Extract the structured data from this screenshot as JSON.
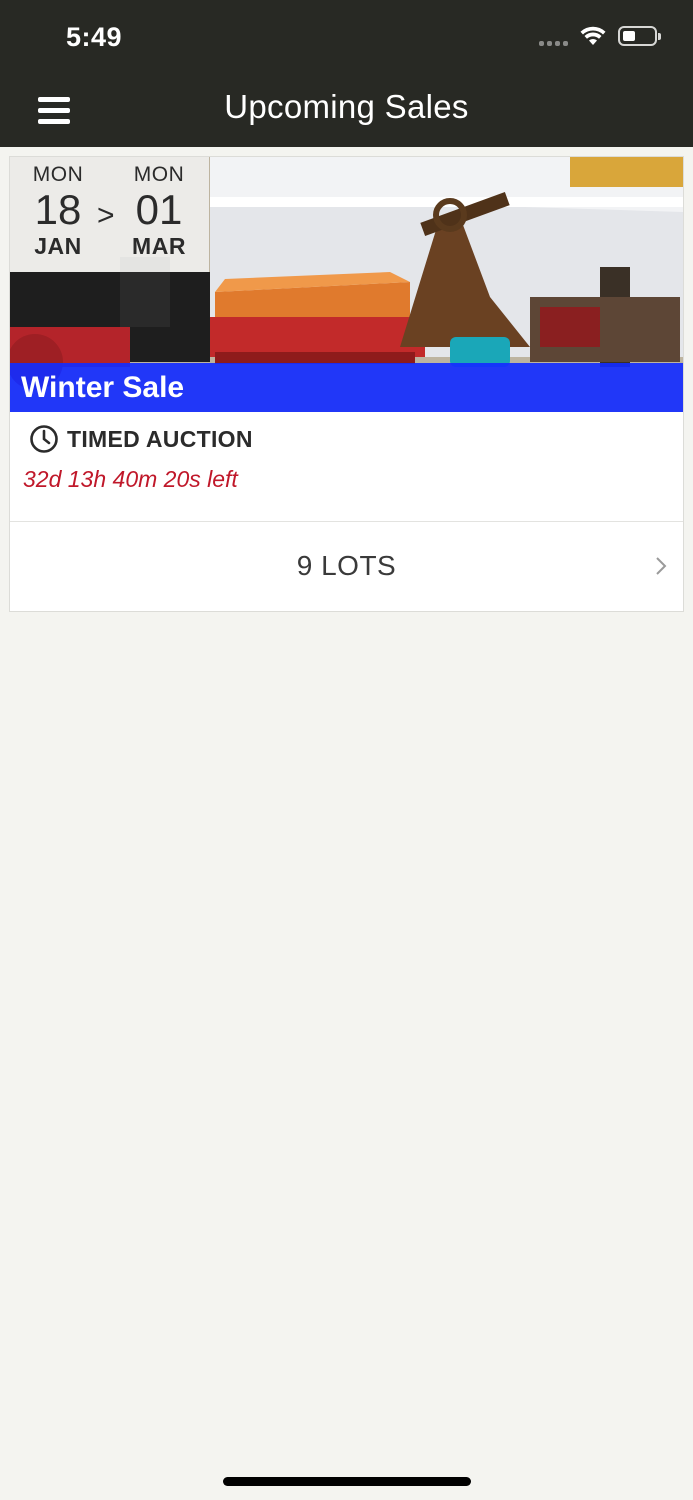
{
  "status_bar": {
    "time": "5:49"
  },
  "nav": {
    "title": "Upcoming Sales",
    "menu_icon": "hamburger-menu-icon"
  },
  "sale": {
    "start": {
      "dow": "MON",
      "day": "18",
      "month": "JAN"
    },
    "separator": ">",
    "end": {
      "dow": "MON",
      "day": "01",
      "month": "MAR"
    },
    "title": "Winter Sale",
    "type_label": "TIMED AUCTION",
    "time_left": "32d 13h 40m 20s left",
    "lots_label": "9 LOTS"
  },
  "colors": {
    "header_bg": "#282924",
    "title_bar": "#1430ff",
    "time_left": "#c0182a",
    "page_bg": "#f4f4f0"
  }
}
